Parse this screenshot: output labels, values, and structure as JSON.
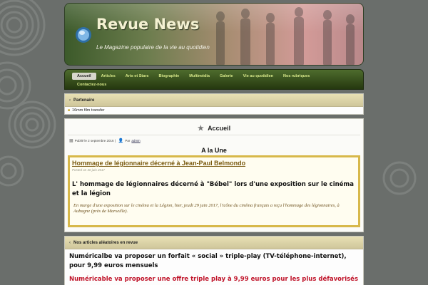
{
  "header": {
    "site_title": "Revue News",
    "tagline": "Le Magazine populaire de la vie au quotidien"
  },
  "nav": {
    "items": [
      {
        "label": "Accueil",
        "active": true
      },
      {
        "label": "Articles",
        "active": false
      },
      {
        "label": "Arts et Stars",
        "active": false
      },
      {
        "label": "Biographie",
        "active": false
      },
      {
        "label": "Multimédia",
        "active": false
      },
      {
        "label": "Galerie",
        "active": false
      },
      {
        "label": "Vie au quotidien",
        "active": false
      },
      {
        "label": "Nos rubriques",
        "active": false
      },
      {
        "label": "Contactez-nous",
        "active": false
      }
    ]
  },
  "partner": {
    "heading": "Partenaire",
    "link": "16mm film transfer"
  },
  "page": {
    "title": "Accueil",
    "meta_published": "Publié le 2 septembre 2016 |",
    "meta_by": "Par",
    "meta_author": "admin",
    "section_heading": "A la Une",
    "featured": {
      "title": "Hommage de légionnaire décerné à Jean-Paul Belmondo",
      "date": "Posted on 30 juin 2017",
      "headline": "L' hommage de légionnaires décerné à \"Bébel\" lors d'une exposition sur le cinéma et la légion",
      "excerpt": "En marge d'une exposition sur le cinéma et la Légion, hier, jeudi 29 juin 2017, l'icône du cinéma français a reçu l'hommage des légionnaires, à Aubagne (près de Marseille)."
    }
  },
  "random_articles": {
    "heading": "Nos articles aléatoires en revue",
    "items": [
      "Numéricalbe va proposer un forfait « social » triple-play (TV-téléphone-internet), pour 9,99 euros mensuels",
      "Numéricable va proposer une offre triple play à 9,99 euros pour les plus défavorisés"
    ]
  },
  "colors": {
    "background": "#6a6e6b",
    "nav_text": "#d8e98a",
    "featured_border": "#d7b84a",
    "featured_title": "#7a5a10",
    "accent_red": "#c0142a"
  }
}
